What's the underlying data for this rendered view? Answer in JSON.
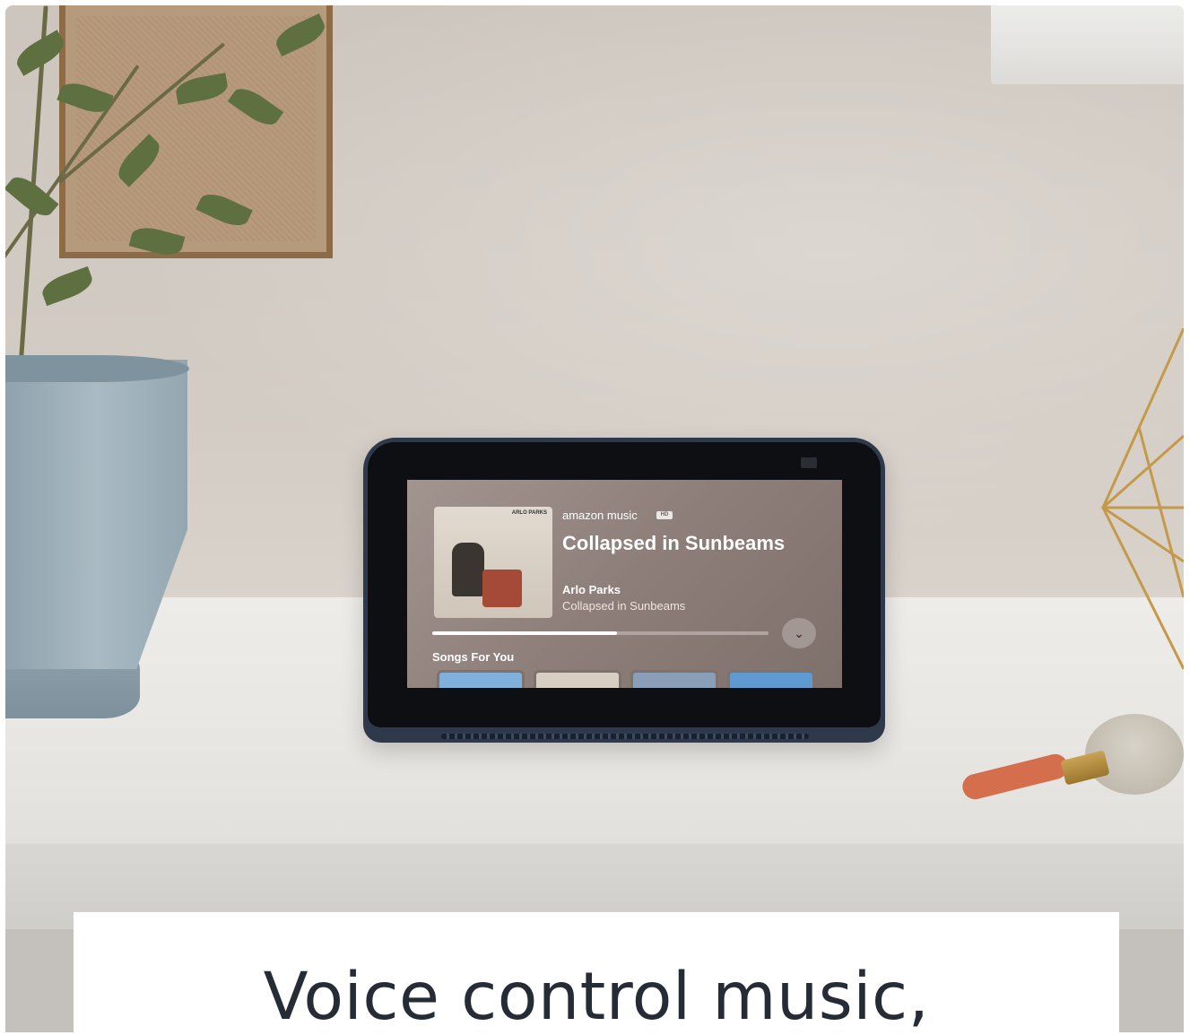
{
  "screen": {
    "brand": "amazon music",
    "brand_badge": "HD",
    "album_art_text": "ARLO PARKS",
    "song_title": "Collapsed in Sunbeams",
    "artist": "Arlo Parks",
    "album": "Collapsed in Sunbeams",
    "progress": 0.55,
    "section_title": "Songs For You",
    "tiles": [
      {
        "color": "#7fb1dc"
      },
      {
        "color": "#d8cfc2"
      },
      {
        "color": "#8a9eb8"
      },
      {
        "color": "#5f9ad3"
      }
    ]
  },
  "caption": {
    "text": "Voice control music,"
  },
  "colors": {
    "device_body": "#2e3a4c",
    "caption_text": "#252c36"
  }
}
